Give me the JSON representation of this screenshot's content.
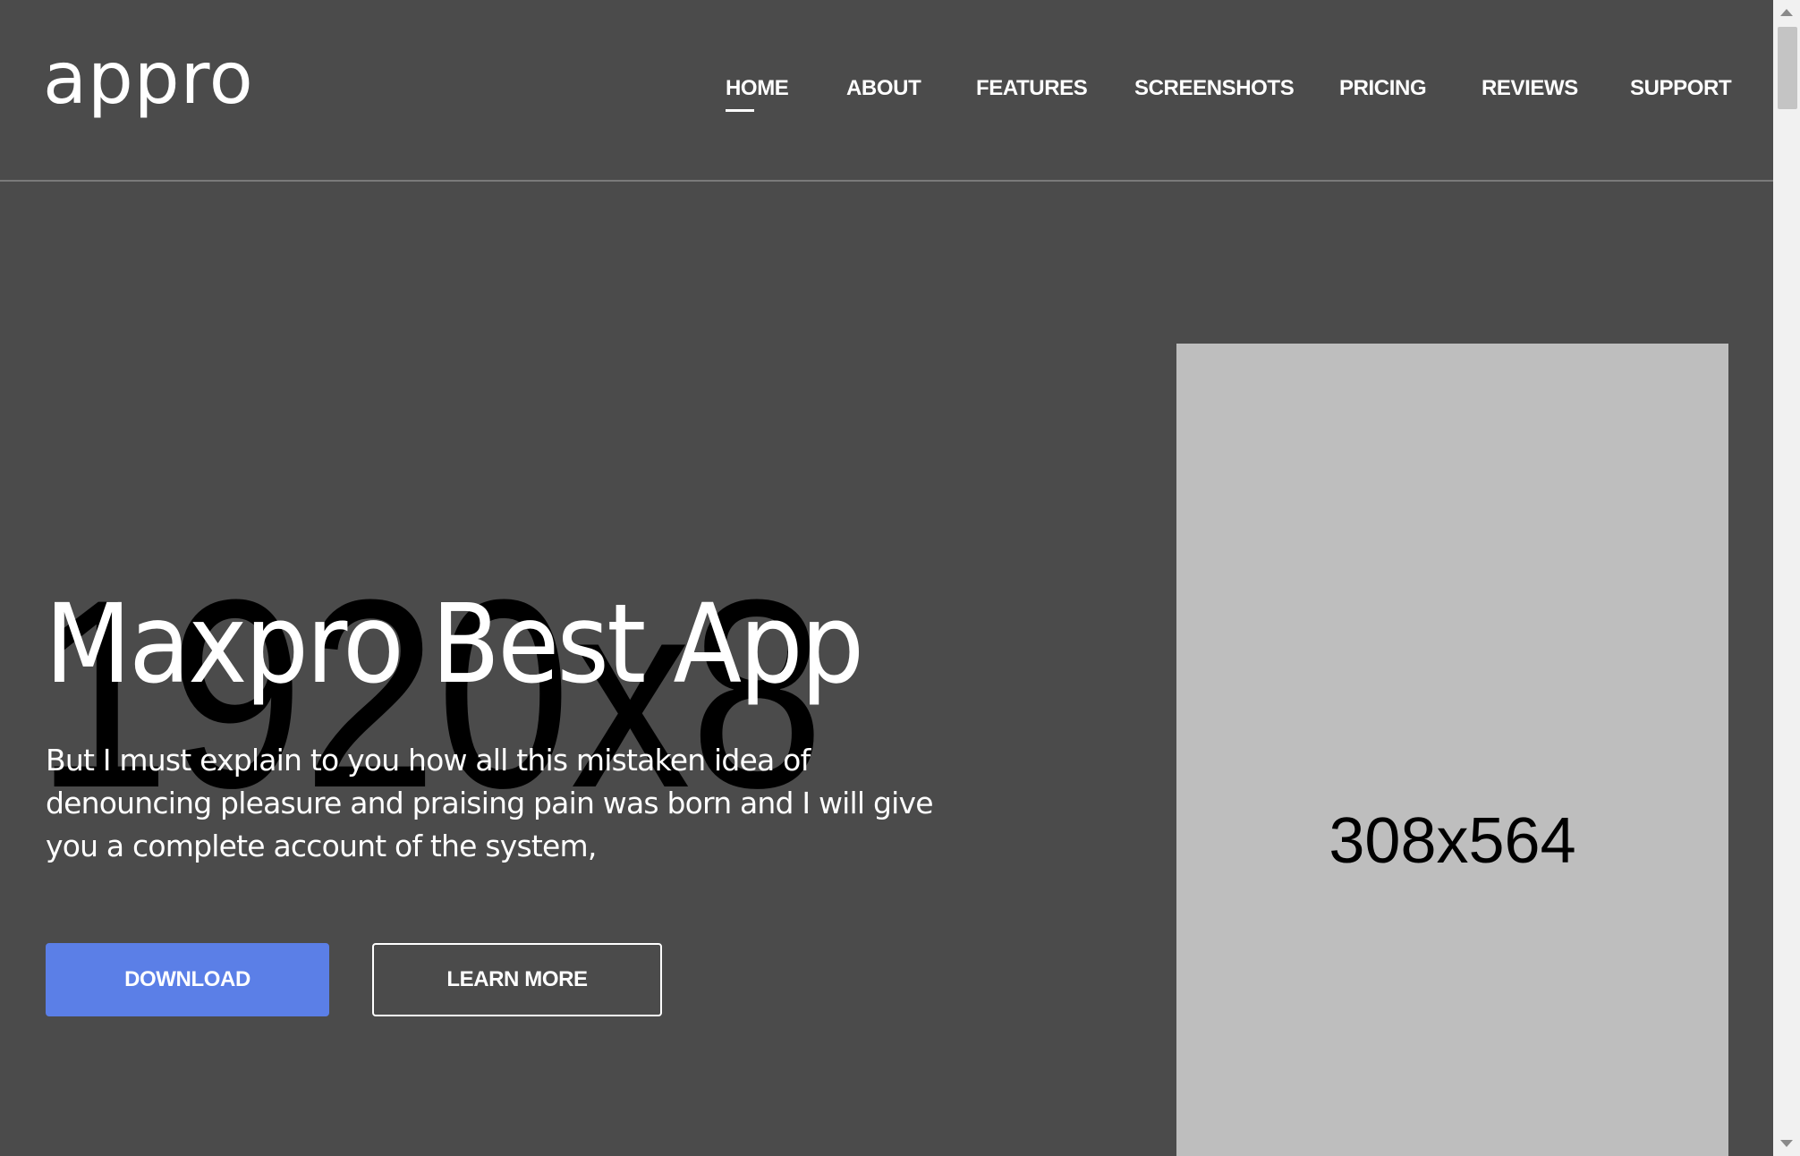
{
  "header": {
    "logo": "appro",
    "nav": [
      {
        "label": "HOME",
        "active": true
      },
      {
        "label": "ABOUT"
      },
      {
        "label": "FEATURES"
      },
      {
        "label": "SCREENSHOTS"
      },
      {
        "label": "PRICING"
      },
      {
        "label": "REVIEWS"
      },
      {
        "label": "SUPPORT"
      }
    ]
  },
  "hero": {
    "background_placeholder": "1920x8",
    "title": "Maxpro Best App",
    "text": "But I must explain to you how all this mistaken idea of denouncing pleasure and praising pain was born and I will give you a complete account of the system,",
    "buttons": {
      "download": "DOWNLOAD",
      "learn_more": "LEARN MORE"
    },
    "phone_placeholder": "308x564"
  },
  "colors": {
    "background": "#4b4b4b",
    "accent": "#5b7fe7",
    "placeholder": "#bebebe"
  }
}
